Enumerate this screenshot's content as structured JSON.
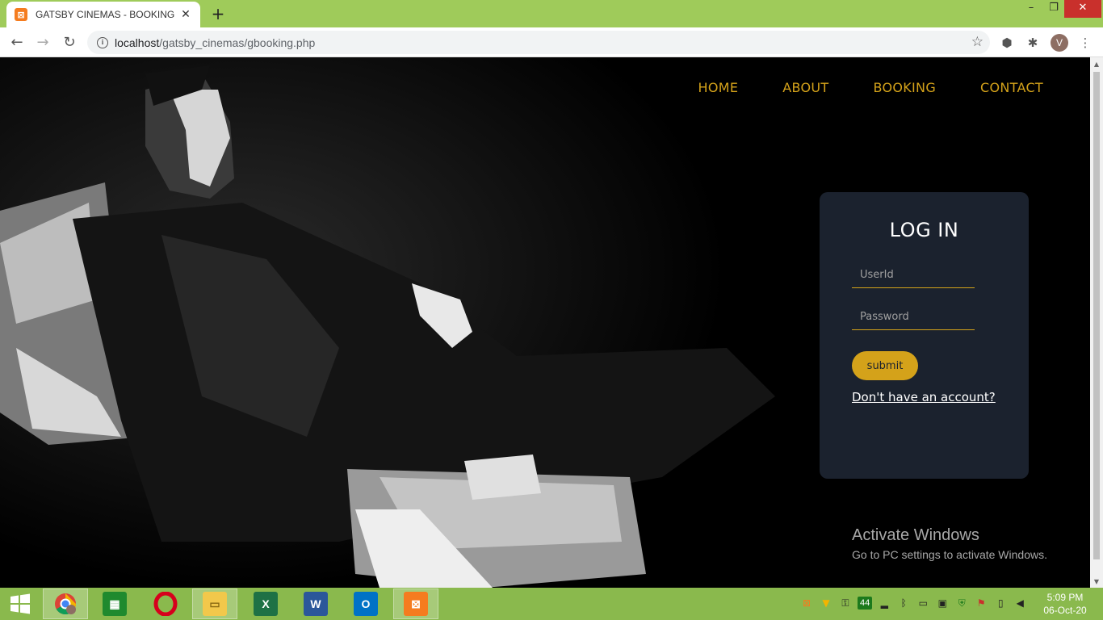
{
  "browser": {
    "tab_title": "GATSBY CINEMAS - BOOKING",
    "tab_close": "✕",
    "new_tab": "+",
    "url_host": "localhost",
    "url_path": "/gatsby_cinemas/gbooking.php",
    "avatar_letter": "V",
    "window_controls": {
      "minimize": "–",
      "restore": "❐",
      "close": "✕"
    }
  },
  "site": {
    "nav": [
      "HOME",
      "ABOUT",
      "BOOKING",
      "CONTACT"
    ],
    "accent_color": "#d4a21a",
    "panel_color": "#1b222e"
  },
  "login": {
    "title": "LOG IN",
    "userid_placeholder": "UserId",
    "password_placeholder": "Password",
    "submit_label": "submit",
    "signup_link": "Don't have an account?"
  },
  "watermark": {
    "line1": "Activate Windows",
    "line2": "Go to PC settings to activate Windows."
  },
  "taskbar": {
    "apps": [
      {
        "name": "chrome",
        "icon": "chrome-icon",
        "active": true
      },
      {
        "name": "store",
        "icon": "store-icon",
        "active": false
      },
      {
        "name": "opera",
        "icon": "opera-icon",
        "active": false
      },
      {
        "name": "file-explorer",
        "icon": "folder-icon",
        "active": true
      },
      {
        "name": "excel",
        "icon": "excel-icon",
        "active": false
      },
      {
        "name": "word",
        "icon": "word-icon",
        "active": false
      },
      {
        "name": "outlook",
        "icon": "outlook-icon",
        "active": false
      },
      {
        "name": "xampp",
        "icon": "xampp-icon",
        "active": true
      }
    ],
    "tray_badge": "44",
    "clock_time": "5:09 PM",
    "clock_date": "06-Oct-20"
  }
}
